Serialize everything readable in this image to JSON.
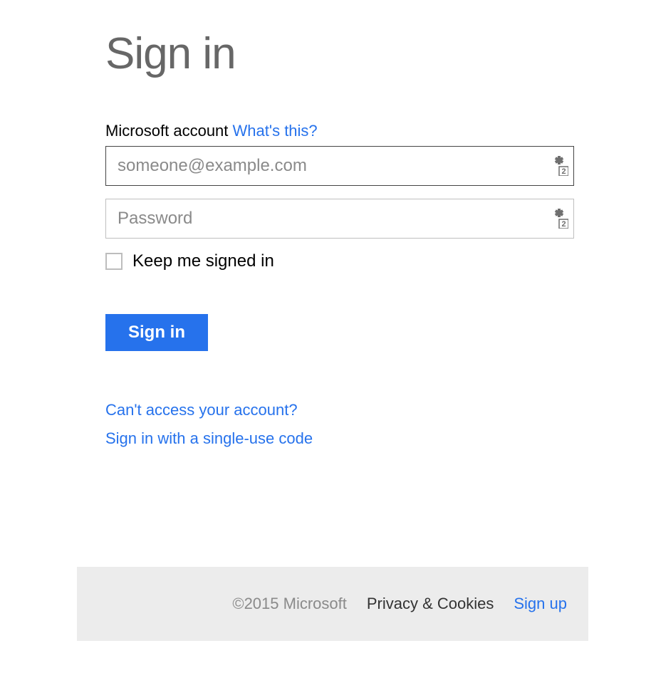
{
  "title": "Sign in",
  "account": {
    "label": "Microsoft account",
    "whats_this": "What's this?"
  },
  "fields": {
    "email_placeholder": "someone@example.com",
    "email_value": "",
    "password_placeholder": "Password",
    "password_value": ""
  },
  "keep_signed_in": {
    "label": "Keep me signed in",
    "checked": false
  },
  "signin_button_label": "Sign in",
  "links": {
    "cant_access": "Can't access your account?",
    "single_use": "Sign in with a single-use code"
  },
  "footer": {
    "copyright": "©2015 Microsoft",
    "privacy": "Privacy & Cookies",
    "signup": "Sign up"
  }
}
